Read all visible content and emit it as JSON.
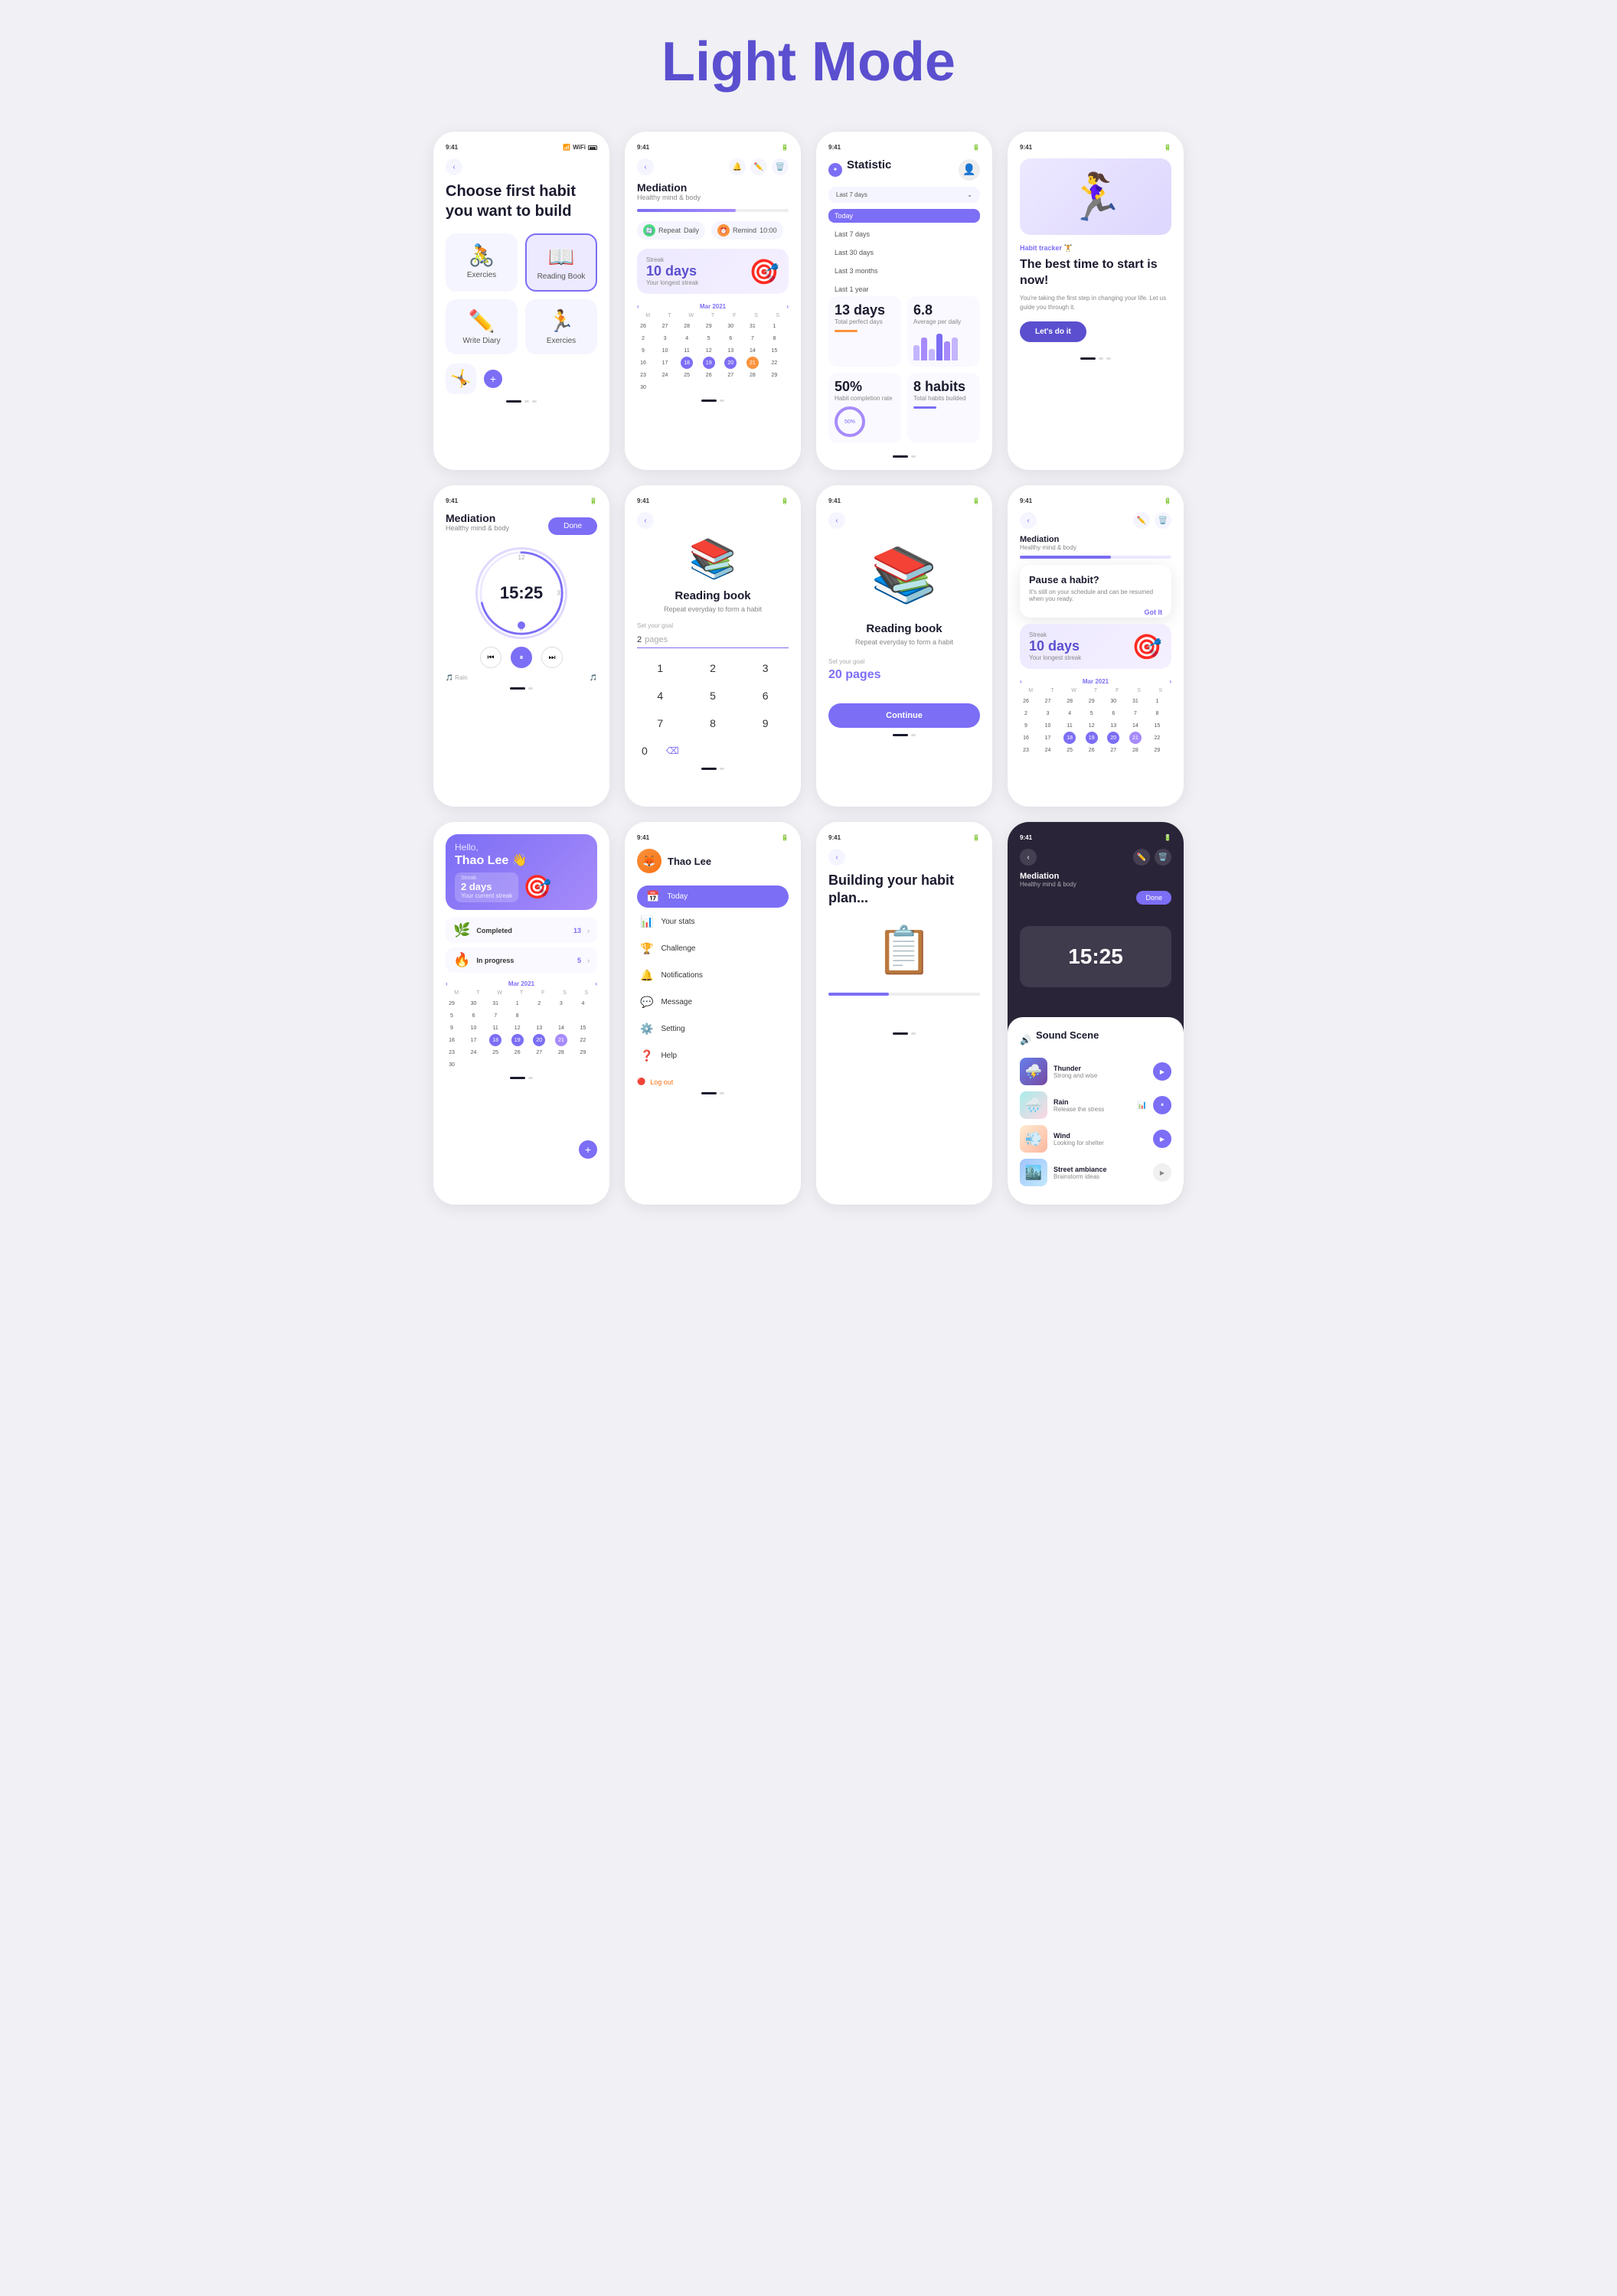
{
  "page": {
    "title": "Light Mode",
    "bg_color": "#f0f0f5",
    "title_color": "#5b4fcf"
  },
  "phones": {
    "row1": [
      {
        "id": "choose-habit",
        "time": "9:41",
        "title": "Choose  first habit\nyou want to build",
        "habits": [
          {
            "name": "Exercies",
            "icon": "🚴",
            "selected": false
          },
          {
            "name": "Reading Book",
            "icon": "📖",
            "selected": true
          },
          {
            "name": "Write Diary",
            "icon": "✏️",
            "selected": false
          },
          {
            "name": "Exercies",
            "icon": "🏃",
            "selected": false
          }
        ]
      },
      {
        "id": "mediation-streak",
        "time": "9:41",
        "title": "Mediation",
        "subtitle": "Healthy mind & body",
        "progress_label": "65% success",
        "repeat": "Daily",
        "remind": "10:00",
        "streak_days": "10 days",
        "streak_label": "Your longest streak",
        "month": "Mar 2021",
        "weekdays": [
          "M",
          "T",
          "W",
          "T",
          "F",
          "S",
          "S"
        ],
        "calendar": [
          [
            "26",
            "27",
            "28",
            "29",
            "30",
            "31",
            "1"
          ],
          [
            "2",
            "3",
            "4",
            "5",
            "6",
            "7",
            "8"
          ],
          [
            "9",
            "10",
            "11",
            "12",
            "13",
            "14",
            "15"
          ],
          [
            "16",
            "17",
            "18",
            "19",
            "20",
            "21",
            "22"
          ],
          [
            "23",
            "24",
            "25",
            "26",
            "27",
            "28",
            "29"
          ],
          [
            "30",
            "",
            "",
            "",
            "",
            "",
            ""
          ]
        ],
        "highlights": [
          "18",
          "19",
          "20"
        ],
        "highlight2": "21"
      },
      {
        "id": "statistic",
        "time": "9:41",
        "title": "Statistic",
        "filter_label": "Last 7 days",
        "options": [
          "Today",
          "Last 7 days",
          "Last 30 days",
          "Last 3 months",
          "Last 1 year"
        ],
        "total_days": "13 days",
        "total_label": "Total perfect days",
        "avg": "6.8",
        "avg_label": "Average per daily",
        "completion": "50%",
        "completion_label": "Habit completion rate",
        "habits_built": "8 habits",
        "habits_label": "Total habits builded"
      },
      {
        "id": "best-time",
        "time": "9:41",
        "label": "Habit tracker 🏋️",
        "title": "The best time to start is now!",
        "subtitle": "You're taking the first step in changing your life. Let us guide you through it.",
        "button": "Let's do it"
      }
    ],
    "row2": [
      {
        "id": "timer",
        "time": "9:41",
        "title": "Mediation",
        "subtitle": "Healthy mind & body",
        "done_btn": "Done",
        "clock_time": "15:25",
        "clock_nums": [
          "12",
          "3",
          "6"
        ],
        "sound_left": "🎵 Rain",
        "sound_right": "sound waves"
      },
      {
        "id": "reading-setup",
        "time": "9:41",
        "title": "Reading book",
        "subtitle": "Repeat everyday to form a habit",
        "goal_label": "Set your goal",
        "goal_value": "2",
        "goal_unit": "pages",
        "numpad": [
          "1",
          "2",
          "3",
          "4",
          "5",
          "6",
          "7",
          "8",
          "9",
          "0"
        ]
      },
      {
        "id": "reading-continue",
        "time": "9:41",
        "title": "Reading book",
        "subtitle": "Repeat everyday to form a habit",
        "goal_label": "Set your goal",
        "goal_value": "20 pages",
        "continue_btn": "Continue"
      },
      {
        "id": "pause-habit",
        "time": "9:41",
        "title": "Mediation",
        "subtitle": "Healthy mind & body",
        "pause_title": "Pause a habit?",
        "pause_sub": "It's still on your schedule and can be resumed when you ready.",
        "got_it": "Got It",
        "streak_days": "10 days",
        "streak_label": "Your longest streak",
        "month": "Mar 2021"
      }
    ],
    "row3": [
      {
        "id": "hello",
        "greeting": "Hello,",
        "name": "Thao Lee 👋",
        "streak_days": "2 days",
        "streak_label": "Your current streak",
        "completed_label": "Completed",
        "completed_count": "13",
        "inprogress_label": "In progress",
        "inprogress_count": "5",
        "month": "Mar 2021"
      },
      {
        "id": "profile-menu",
        "time": "9:41",
        "user_name": "Thao Lee",
        "menu_items": [
          {
            "icon": "📅",
            "label": "Today",
            "active": true
          },
          {
            "icon": "📊",
            "label": "Your stats",
            "active": false
          },
          {
            "icon": "🏆",
            "label": "Challenge",
            "active": false
          },
          {
            "icon": "🔔",
            "label": "Notifications",
            "active": false
          },
          {
            "icon": "💬",
            "label": "Message",
            "active": false
          },
          {
            "icon": "⚙️",
            "label": "Setting",
            "active": false
          },
          {
            "icon": "❓",
            "label": "Help",
            "active": false
          }
        ],
        "logout_label": "Log out"
      },
      {
        "id": "building-plan",
        "time": "9:41",
        "title": "Building your\nhabit plan...",
        "icon": "📋"
      },
      {
        "id": "sound-scene",
        "time": "9:41",
        "title": "Mediation",
        "subtitle": "Healthy mind & body",
        "done_btn": "Done",
        "panel_title": "Sound Scene",
        "sounds": [
          {
            "icon": "⛈️",
            "name": "Thunder",
            "desc": "Strong and wise",
            "type": "thunder",
            "active": true
          },
          {
            "icon": "🌧️",
            "name": "Rain",
            "desc": "Release the stress",
            "type": "rain",
            "active": false,
            "wave": true
          },
          {
            "icon": "💨",
            "name": "Wind",
            "desc": "Looking for shelter",
            "type": "wind",
            "active": true
          },
          {
            "icon": "🏙️",
            "name": "Street ambiance",
            "desc": "Brainstorm ideas",
            "type": "street",
            "active": false
          }
        ]
      }
    ]
  }
}
